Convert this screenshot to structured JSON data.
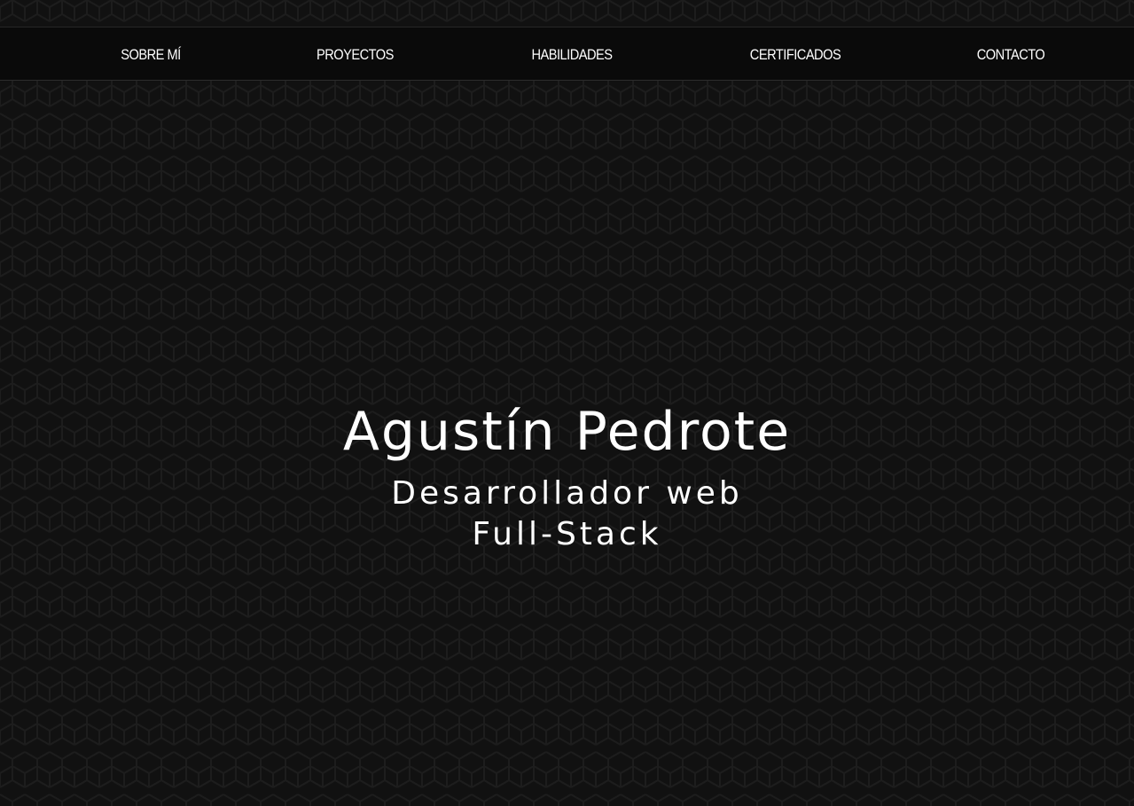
{
  "nav": {
    "items": [
      {
        "label": "SOBRE MÍ"
      },
      {
        "label": "PROYECTOS"
      },
      {
        "label": "HABILIDADES"
      },
      {
        "label": "CERTIFICADOS"
      },
      {
        "label": "CONTACTO"
      }
    ]
  },
  "hero": {
    "name": "Agustín Pedrote",
    "role_line1": "Desarrollador web",
    "role_line2": "Full-Stack"
  },
  "colors": {
    "background": "#111111",
    "navbar": "#0a0a0a",
    "text": "#ffffff",
    "pattern_stroke": "#1c1c1c"
  }
}
